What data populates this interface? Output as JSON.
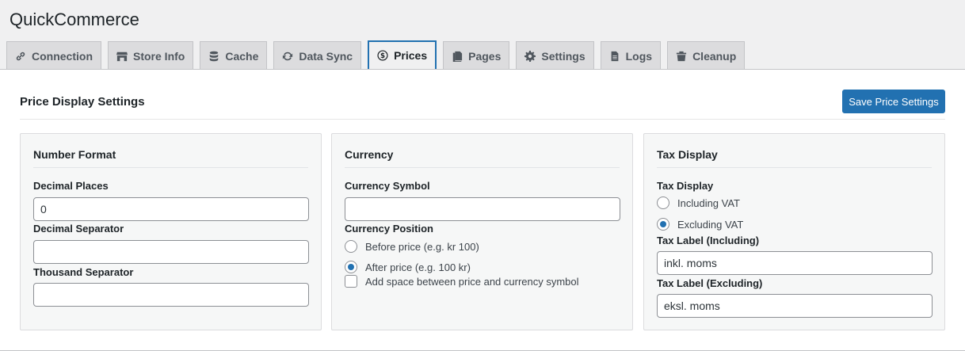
{
  "app": {
    "title": "QuickCommerce"
  },
  "tabs": [
    {
      "label": "Connection",
      "icon": "link-icon",
      "active": false
    },
    {
      "label": "Store Info",
      "icon": "store-icon",
      "active": false
    },
    {
      "label": "Cache",
      "icon": "database-icon",
      "active": false
    },
    {
      "label": "Data Sync",
      "icon": "sync-icon",
      "active": false
    },
    {
      "label": "Prices",
      "icon": "dollar-icon",
      "active": true
    },
    {
      "label": "Pages",
      "icon": "pages-icon",
      "active": false
    },
    {
      "label": "Settings",
      "icon": "gear-icon",
      "active": false
    },
    {
      "label": "Logs",
      "icon": "document-icon",
      "active": false
    },
    {
      "label": "Cleanup",
      "icon": "trash-icon",
      "active": false
    }
  ],
  "panel": {
    "title": "Price Display Settings",
    "save_label": "Save Price Settings"
  },
  "number_format": {
    "title": "Number Format",
    "decimal_places_label": "Decimal Places",
    "decimal_places_value": "0",
    "decimal_separator_label": "Decimal Separator",
    "decimal_separator_value": "",
    "thousand_separator_label": "Thousand Separator",
    "thousand_separator_value": ""
  },
  "currency": {
    "title": "Currency",
    "symbol_label": "Currency Symbol",
    "symbol_value": "",
    "position_label": "Currency Position",
    "before_label": "Before price (e.g. kr 100)",
    "after_label": "After price (e.g. 100 kr)",
    "selected": "after",
    "space_label": "Add space between price and currency symbol",
    "space_checked": false
  },
  "tax": {
    "title": "Tax Display",
    "display_label": "Tax Display",
    "including_label": "Including VAT",
    "excluding_label": "Excluding VAT",
    "selected": "excluding",
    "label_including_label": "Tax Label (Including)",
    "label_including_value": "inkl. moms",
    "label_excluding_label": "Tax Label (Excluding)",
    "label_excluding_value": "eksl. moms"
  },
  "colors": {
    "accent": "#2271b1",
    "background": "#f0f0f1"
  }
}
